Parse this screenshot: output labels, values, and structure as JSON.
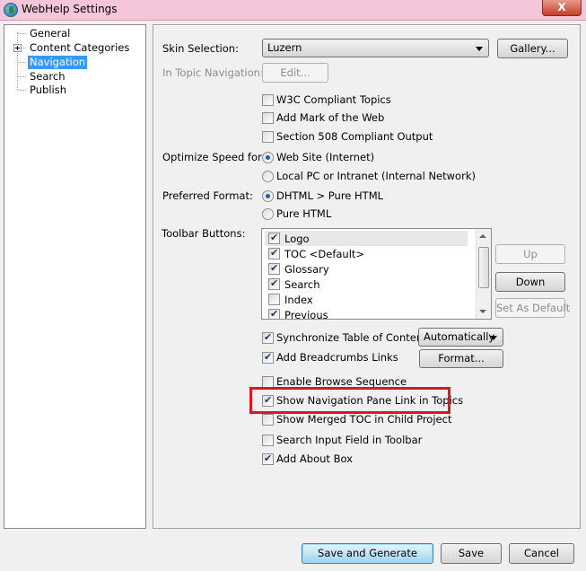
{
  "window": {
    "title": "WebHelp Settings",
    "close_glyph": "X"
  },
  "tree": {
    "items": [
      {
        "label": "General",
        "selected": false
      },
      {
        "label": "Content Categories",
        "selected": false
      },
      {
        "label": "Navigation",
        "selected": true
      },
      {
        "label": "Search",
        "selected": false
      },
      {
        "label": "Publish",
        "selected": false
      }
    ]
  },
  "skin": {
    "label": "Skin Selection:",
    "value": "Luzern",
    "gallery_button": "Gallery..."
  },
  "in_topic": {
    "label": "In Topic Navigation:",
    "edit_button": "Edit..."
  },
  "compliance": [
    {
      "label": "W3C Compliant Topics",
      "checked": false
    },
    {
      "label": "Add Mark of the Web",
      "checked": false
    },
    {
      "label": "Section 508 Compliant Output",
      "checked": false
    }
  ],
  "optimize": {
    "label": "Optimize Speed for:",
    "options": [
      {
        "label": "Web Site (Internet)",
        "selected": true
      },
      {
        "label": "Local PC or Intranet (Internal Network)",
        "selected": false
      }
    ]
  },
  "format": {
    "label": "Preferred Format:",
    "options": [
      {
        "label": "DHTML > Pure HTML",
        "selected": true
      },
      {
        "label": "Pure HTML",
        "selected": false
      }
    ]
  },
  "toolbar": {
    "label": "Toolbar Buttons:",
    "items": [
      {
        "label": "Logo",
        "checked": true
      },
      {
        "label": "TOC <Default>",
        "checked": true
      },
      {
        "label": "Glossary",
        "checked": true
      },
      {
        "label": "Search",
        "checked": true
      },
      {
        "label": "Index",
        "checked": false
      },
      {
        "label": "Previous",
        "checked": true
      }
    ],
    "up_button": "Up",
    "down_button": "Down",
    "set_default_button": "Set As Default"
  },
  "sync": {
    "label": "Synchronize Table of Contents",
    "checked": true,
    "value": "Automatically"
  },
  "breadcrumbs": {
    "label": "Add Breadcrumbs Links",
    "checked": true,
    "format_button": "Format..."
  },
  "options": [
    {
      "label": "Enable Browse Sequence",
      "checked": false
    },
    {
      "label": "Show Navigation Pane Link in Topics",
      "checked": true
    },
    {
      "label": "Show Merged TOC in Child Project",
      "checked": false
    },
    {
      "label": "Search Input Field in Toolbar",
      "checked": false
    },
    {
      "label": "Add About Box",
      "checked": true
    }
  ],
  "footer": {
    "save_generate": "Save and Generate",
    "save": "Save",
    "cancel": "Cancel"
  },
  "colors": {
    "title_bar": "#f5c6d9",
    "selection": "#3399ff",
    "highlight_box": "#e3141b"
  }
}
